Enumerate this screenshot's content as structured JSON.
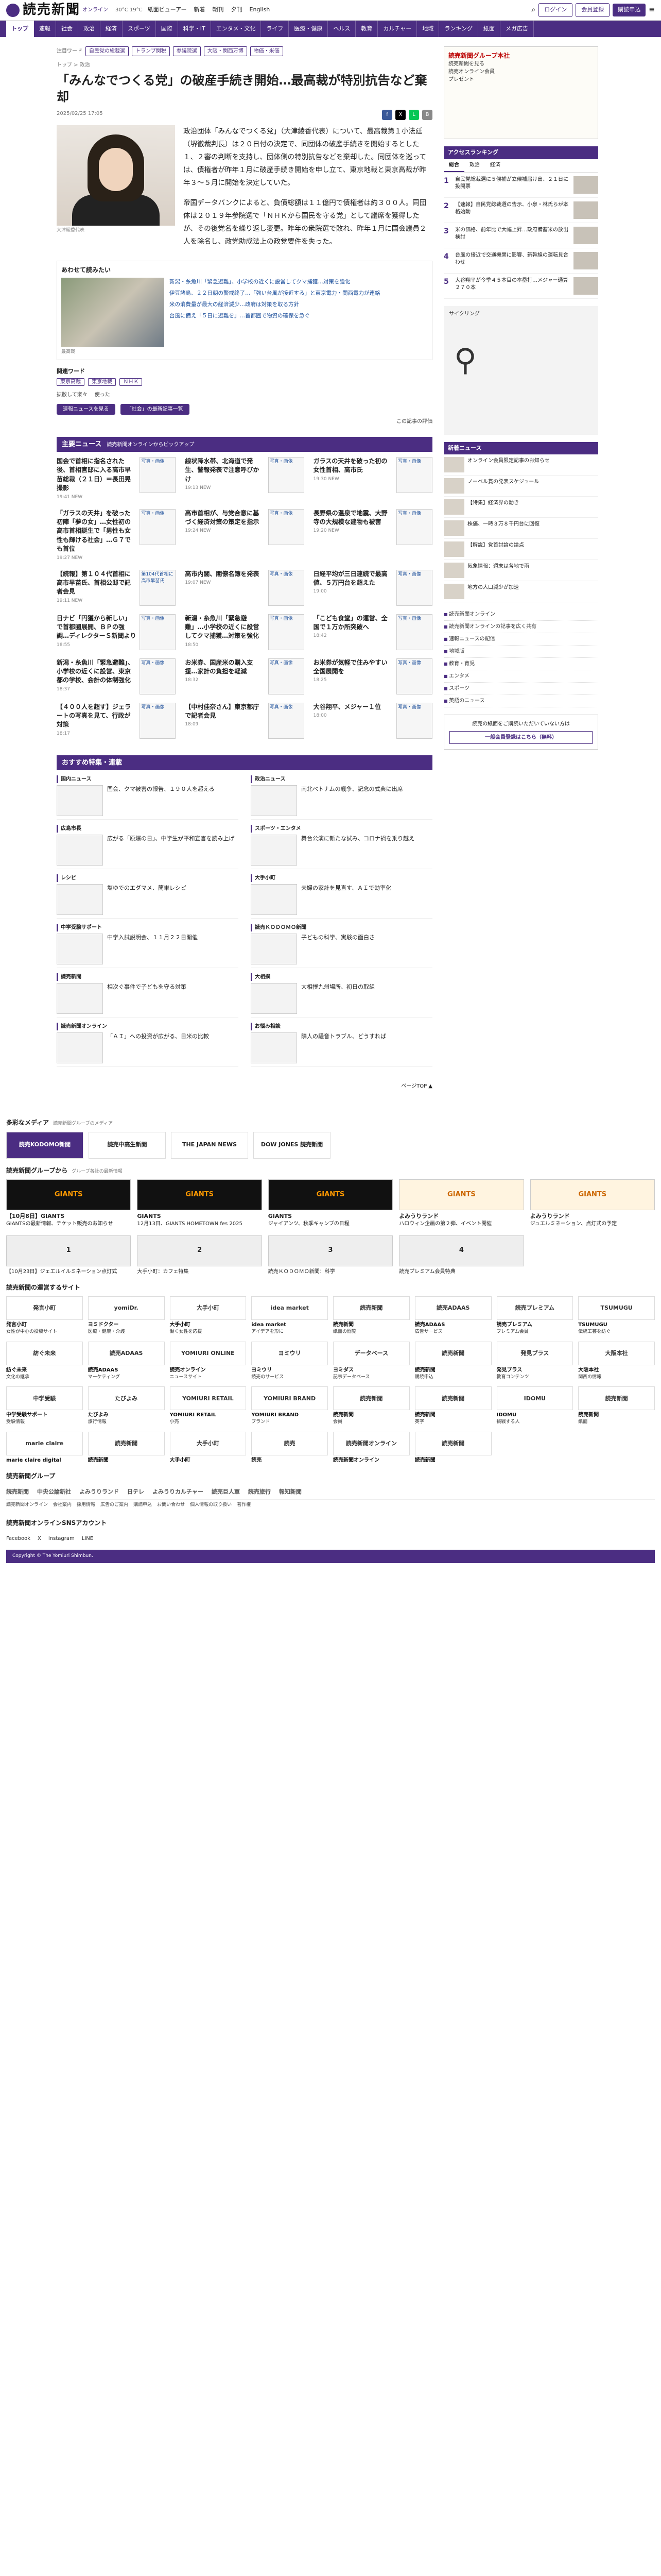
{
  "header": {
    "logo": "読売新聞",
    "logo_sub": "オンライン",
    "weather": "30°C 19°C",
    "nav": [
      "紙面ビューアー",
      "新着",
      "朝刊",
      "夕刊",
      "English"
    ],
    "subscribe": "購読申込",
    "login": "ログイン",
    "register": "会員登録",
    "menu": "≡"
  },
  "navbar": [
    "トップ",
    "速報",
    "社会",
    "政治",
    "経済",
    "スポーツ",
    "国際",
    "科学・IT",
    "エンタメ・文化",
    "ライフ",
    "医療・健康",
    "ヘルス",
    "教育",
    "カルチャー",
    "地域",
    "ランキング",
    "紙面",
    "メガ広告"
  ],
  "trend": {
    "label": "注目ワード",
    "tags": [
      "自民党の総裁選",
      "トランプ関税",
      "参議院選",
      "大阪・関西万博",
      "物価・米価"
    ]
  },
  "article": {
    "crumb": "トップ > 政治",
    "title": "「みんなでつくる党」の破産手続き開始…最高裁が特別抗告など棄却",
    "date": "2025/02/25 17:05",
    "share_label": "拡散して楽々",
    "caption": "大津綾香代表",
    "paragraphs": [
      "政治団体「みんなでつくる党」（大津綾香代表）について、最高裁第１小法廷（堺徹裁判長）は２０日付の決定で、同団体の破産手続きを開始するとした１、２審の判断を支持し、団体側の特別抗告などを棄却した。同団体を巡っては、債権者が昨年１月に破産手続き開始を申し立て、東京地裁と東京高裁が昨年３～５月に開始を決定していた。",
      "帝国データバンクによると、負債総額は１１億円で債権者は約３００人。同団体は２０１９年参院選で「ＮＨＫから国民を守る党」として議席を獲得したが、その後党名を繰り返し変更。昨年の衆院選で敗れ、昨年１月に国会議員２人を除名し、政党助成法上の政党要件を失った。"
    ]
  },
  "related": {
    "heading": "あわせて読みたい",
    "items": [
      "新潟・糸魚川「緊急避難」、小学校の近くに設営してクマ捕獲…対策を強化",
      "伊豆諸島、２２日朝の警戒終了…「強い台風が接近する」と東京電力・関西電力が連絡",
      "米の消費量が最大の経済減少…政府は対策を取る方針",
      "台風に備え「５日に避難を」…首都圏で物資の確保を急ぐ"
    ],
    "img_caption": "最高裁"
  },
  "keywords": {
    "label": "関連ワード",
    "tags": [
      "東京高裁",
      "東京地裁",
      "ＮＨＫ"
    ]
  },
  "actions": [
    "拡散して楽々",
    "使った"
  ],
  "pills": [
    "速報ニュースを見る",
    "「社会」の最新記事一覧"
  ],
  "print_note": "この記事の評価",
  "sidebar": {
    "ad1": {
      "head": "読売新聞グループ本社",
      "lines": [
        "読売新聞を見る",
        "読売オンライン会員",
        "プレゼント"
      ]
    },
    "ranking": {
      "head": "アクセスランキング",
      "tabs": [
        "総合",
        "政治",
        "経済"
      ],
      "items": [
        "自民党総裁選に５候補が立候補届け出、２１日に投開票",
        "【速報】自民党総裁選の告示、小泉・林氏らが本格始動",
        "米の価格、前年比で大幅上昇…政府備蓄米の放出検討",
        "台風の接近で交通機関に影響、新幹線の運転見合わせ",
        "大谷翔平が今季４５本目の本塁打…メジャー通算２７０本"
      ]
    },
    "ad2": "サイクリング",
    "newhead": "新着ニュース",
    "news": [
      "オンライン会員限定記事のお知らせ",
      "ノーベル賞の発表スケジュール",
      "【特集】経済界の動き",
      "株価、一時３万８千円台に回復",
      "【解説】党首討論の論点",
      "気象情報：週末は各地で雨",
      "地方の人口減少が加速"
    ],
    "links": [
      "読売新聞オンライン",
      "読売新聞オンラインの記事を広く共有",
      "速報ニュースの配信",
      "地域版",
      "教育・育児",
      "エンタメ",
      "スポーツ",
      "英語のニュース"
    ],
    "subs": "読売の紙面をご購読いただいていない方は",
    "subs_btn": "一般会員登録はこちら（無料）"
  },
  "mainnews": {
    "head": "主要ニュース",
    "sub": "読売新聞オンラインからピックアップ",
    "items": [
      {
        "t": "国会で首相に指名された後、首相官邸に入る高市早苗総裁（２１日）＝長田晃撮影",
        "m": "19:41 NEW",
        "ph": "写真・画像"
      },
      {
        "t": "線状降水帯、北海道で発生、警報発表で注意呼びかけ",
        "m": "19:13 NEW",
        "ph": "写真・画像"
      },
      {
        "t": "ガラスの天井を破った初の女性首相、高市氏",
        "m": "19:30 NEW",
        "ph": "写真・画像"
      },
      {
        "t": "「ガラスの天井」を破った初陣「夢の女」…女性初の高市首相誕生で「男性も女性も輝ける社会」…Ｇ７でも首位",
        "m": "19:27 NEW",
        "ph": "写真・画像"
      },
      {
        "t": "高市首相が、与党合意に基づく経済対策の策定を指示",
        "m": "19:24 NEW",
        "ph": "写真・画像"
      },
      {
        "t": "長野県の温泉で地震、大野寺の大規模な建物も被害",
        "m": "19:20 NEW",
        "ph": "写真・画像"
      },
      {
        "t": "【続報】第１０４代首相に高市早苗氏、首相公邸で記者会見",
        "m": "19:11 NEW",
        "ph": "第104代首相に高市早苗氏"
      },
      {
        "t": "高市内閣、閣僚名簿を発表",
        "m": "19:07 NEW",
        "ph": "写真・画像"
      },
      {
        "t": "日経平均が三日連続で最高値、５万円台を超えた",
        "m": "19:00",
        "ph": "写真・画像"
      },
      {
        "t": "日ナビ「円獲から新しい」で首都圏展開、ＢＰの強調…ディレクターＳ新聞より",
        "m": "18:55",
        "ph": "写真・画像"
      },
      {
        "t": "新潟・糸魚川「緊急避難」…小学校の近くに設営してクマ捕獲…対策を強化",
        "m": "18:50",
        "ph": "写真・画像"
      },
      {
        "t": "「こども食堂」の運営、全国で１万か所突破へ",
        "m": "18:42",
        "ph": "写真・画像"
      },
      {
        "t": "新潟・糸魚川「緊急避難」、小学校の近くに設営、東京都の学校、会計の体制強化",
        "m": "18:37",
        "ph": "写真・画像"
      },
      {
        "t": "お米券、国産米の購入支援…家計の負担を軽減",
        "m": "18:32",
        "ph": "写真・画像"
      },
      {
        "t": "お米券が気軽で住みやすい全国展開を",
        "m": "18:25",
        "ph": "写真・画像"
      },
      {
        "t": "【４００人を超す】ジェラートの写真を見て、行政が対策",
        "m": "18:17",
        "ph": "写真・画像"
      },
      {
        "t": "【中村佳奈さん】東京都庁で記者会見",
        "m": "18:09",
        "ph": "写真・画像"
      },
      {
        "t": "大谷翔平、メジャー１位",
        "m": "18:00",
        "ph": "写真・画像"
      }
    ]
  },
  "special": {
    "head": "おすすめ特集・連載",
    "cols": [
      {
        "h": "国内ニュース",
        "t": "国会、クマ被害の報告、１９０人を超える"
      },
      {
        "h": "政治ニュース",
        "t": "南北ベトナムの戦争、記念の式典に出席"
      },
      {
        "h": "広島市長",
        "t": "広がる「原爆の日」、中学生が平和宣言を読み上げ"
      },
      {
        "h": "スポーツ・エンタメ",
        "t": "舞台公演に新たな試み、コロナ禍を乗り越え"
      },
      {
        "h": "レシピ",
        "t": "塩ゆでのエダマメ、簡単レシピ"
      },
      {
        "h": "大手小町",
        "t": "夫婦の家計を見直す、ＡＩで効率化"
      },
      {
        "h": "中学受験サポート",
        "t": "中学入試説明会、１１月２２日開催"
      },
      {
        "h": "読売ＫＯＤＯＭＯ新聞",
        "t": "子どもの科学、実験の面白さ"
      },
      {
        "h": "読売新聞",
        "t": "相次ぐ事件で子どもを守る対策"
      },
      {
        "h": "大相撲",
        "t": "大相撲九州場所、初日の取組"
      },
      {
        "h": "読売新聞オンライン",
        "t": "「ＡＩ」への投資が広がる、日米の比較"
      },
      {
        "h": "お悩み相談",
        "t": "隣人の騒音トラブル、どうすれば"
      }
    ],
    "pagetop": "ページTOP ▲"
  },
  "footer": {
    "media_head": "多彩なメディア",
    "media_sub": "読売新聞グループのメディア",
    "media": [
      "読売KODOMO新聞",
      "読売中高生新聞",
      "THE JAPAN NEWS",
      "DOW JONES 読売新聞"
    ],
    "group_head": "読売新聞グループから",
    "group_sub": "グループ各社の最新情報",
    "group": [
      {
        "i": "GIANTS",
        "b": "【10月8日】GIANTS",
        "t": "GIANTSの最新情報、チケット販売のお知らせ"
      },
      {
        "i": "GIANTS",
        "b": "GIANTS",
        "t": "12月13日、GIANTS HOMETOWN fes 2025"
      },
      {
        "i": "GIANTS",
        "b": "GIANTS",
        "t": "ジャイアンツ、秋季キャンプの日程"
      },
      {
        "i": "GIANTS",
        "b": "よみうりランド",
        "t": "ハロウィン企画の第２弾、イベント開催"
      },
      {
        "i": "GIANTS",
        "b": "よみうりランド",
        "t": "ジュエルミネーション、点灯式の予定"
      }
    ],
    "tickets": [
      {
        "i": "1",
        "t": "【10月23日】ジェエルイルミネーション点灯式"
      },
      {
        "i": "2",
        "t": "大手小町：カフェ特集"
      },
      {
        "i": "3",
        "t": "読売ＫＯＤＯＭＯ新聞：科学"
      },
      {
        "i": "4",
        "t": "読売プレミアム会員特典"
      }
    ],
    "sites_head": "読売新聞の運営するサイト",
    "sites": [
      {
        "l": "発言小町",
        "b": "発言小町",
        "t": "女性が中心の投稿サイト"
      },
      {
        "l": "yomiDr.",
        "b": "ヨミドクター",
        "t": "医療・健康・介護"
      },
      {
        "l": "大手小町",
        "b": "大手小町",
        "t": "働く女性を応援"
      },
      {
        "l": "idea market",
        "b": "idea market",
        "t": "アイデアを形に"
      },
      {
        "l": "読売新聞",
        "b": "読売新聞",
        "t": "紙面の閲覧"
      },
      {
        "l": "読売ADAAS",
        "b": "読売ADAAS",
        "t": "広告サービス"
      },
      {
        "l": "読売プレミアム",
        "b": "読売プレミアム",
        "t": "プレミアム会員"
      },
      {
        "l": "TSUMUGU",
        "b": "TSUMUGU",
        "t": "伝統工芸を紡ぐ"
      },
      {
        "l": "紡ぐ未来",
        "b": "紡ぐ未来",
        "t": "文化の継承"
      },
      {
        "l": "読売ADAAS",
        "b": "読売ADAAS",
        "t": "マーケティング"
      },
      {
        "l": "YOMIURI ONLINE",
        "b": "読売オンライン",
        "t": "ニュースサイト"
      },
      {
        "l": "ヨミウリ",
        "b": "ヨミウリ",
        "t": "読売のサービス"
      },
      {
        "l": "データベース",
        "b": "ヨミダス",
        "t": "記事データベース"
      },
      {
        "l": "読売新聞",
        "b": "読売新聞",
        "t": "購読申込"
      },
      {
        "l": "発見プラス",
        "b": "発見プラス",
        "t": "教育コンテンツ"
      },
      {
        "l": "大阪本社",
        "b": "大阪本社",
        "t": "関西の情報"
      },
      {
        "l": "中学受験",
        "b": "中学受験サポート",
        "t": "受験情報"
      },
      {
        "l": "たびよみ",
        "b": "たびよみ",
        "t": "旅行情報"
      },
      {
        "l": "YOMIURI RETAIL",
        "b": "YOMIURI RETAIL",
        "t": "小売"
      },
      {
        "l": "YOMIURI BRAND",
        "b": "YOMIURI BRAND",
        "t": "ブランド"
      },
      {
        "l": "読売新聞",
        "b": "読売新聞",
        "t": "会員"
      },
      {
        "l": "読売新聞",
        "b": "読売新聞",
        "t": "英字"
      },
      {
        "l": "IDOMU",
        "b": "IDOMU",
        "t": "挑戦する人"
      },
      {
        "l": "読売新聞",
        "b": "読売新聞",
        "t": "紙面"
      }
    ],
    "brands": [
      {
        "l": "marie claire",
        "b": "marie claire digital"
      },
      {
        "l": "読売新聞",
        "b": "読売新聞"
      },
      {
        "l": "大手小町",
        "b": "大手小町"
      },
      {
        "l": "読売",
        "b": "読売"
      },
      {
        "l": "読売新聞オンライン",
        "b": "読売新聞オンライン"
      },
      {
        "l": "読売新聞",
        "b": "読売新聞"
      }
    ],
    "gr_head": "読売新聞グループ",
    "groups": [
      "読売新聞",
      "中央公論新社",
      "よみうりランド",
      "日テレ",
      "よみうりカルチャー",
      "読売巨人軍",
      "読売旅行",
      "報知新聞"
    ],
    "links": [
      "読売新聞オンライン",
      "会社案内",
      "採用情報",
      "広告のご案内",
      "購読申込",
      "お問い合わせ",
      "個人情報の取り扱い",
      "著作権"
    ],
    "sns_head": "読売新聞オンラインSNSアカウント",
    "sns": [
      "Facebook",
      "X",
      "Instagram",
      "LINE"
    ],
    "copyright": "Copyright © The Yomiuri Shimbun."
  }
}
